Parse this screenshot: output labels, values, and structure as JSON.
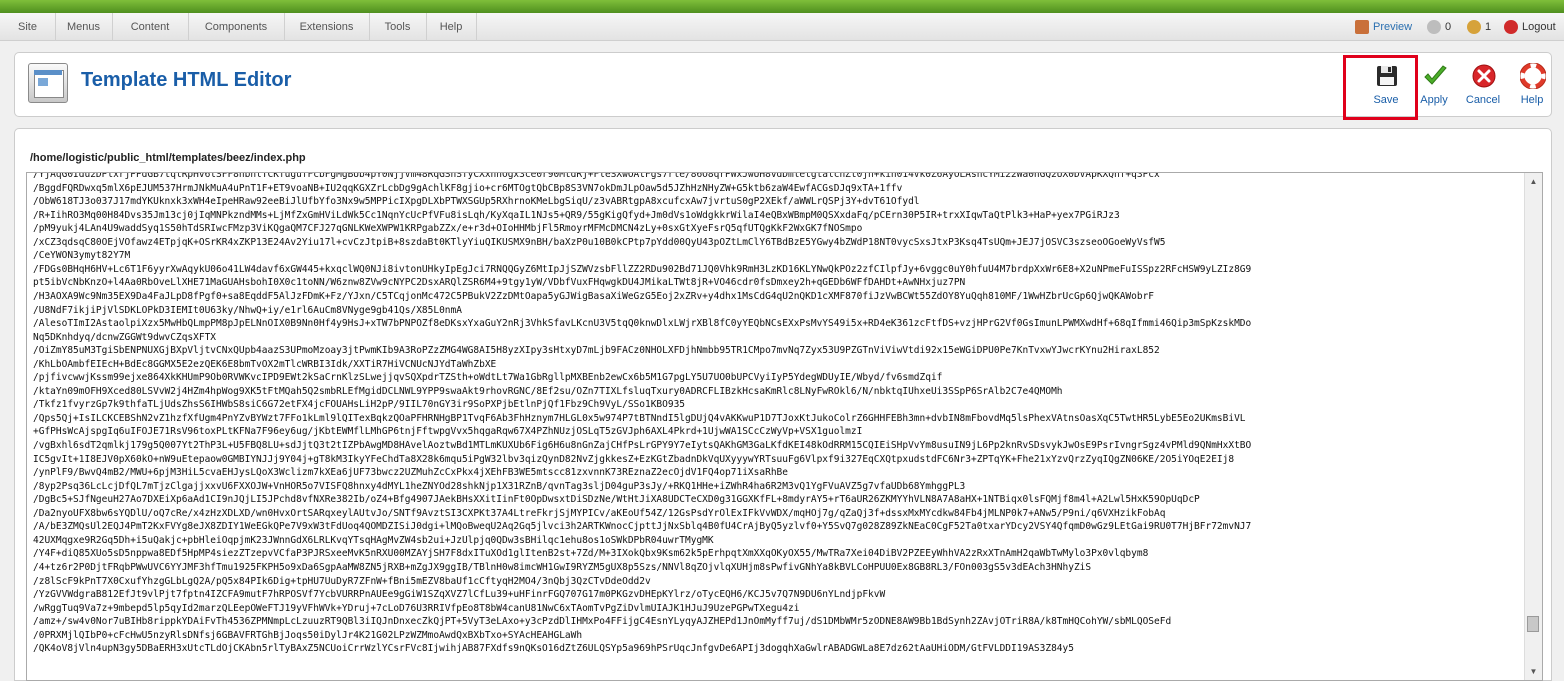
{
  "menu": {
    "items": [
      {
        "label": "Site"
      },
      {
        "label": "Menus"
      },
      {
        "label": "Content"
      },
      {
        "label": "Components"
      },
      {
        "label": "Extensions"
      },
      {
        "label": "Tools"
      },
      {
        "label": "Help"
      }
    ]
  },
  "status": {
    "preview": "Preview",
    "messages_count": "0",
    "users_count": "1",
    "logout": "Logout"
  },
  "header": {
    "title": "Template HTML Editor"
  },
  "toolbar": {
    "save": "Save",
    "apply": "Apply",
    "cancel": "Cancel",
    "help": "Help"
  },
  "editor": {
    "file_path": "/home/logistic/public_html/templates/beez/index.php",
    "lines": [
      "/YjAqG0Idu2DPlxrjPPdGB7tqlRpHv6lSFF8hbhlTCKfugufFcbFgMgBUb4pY0NjjVm48RqGSnSfyCXxhhOgx3ce0r90MtdRj+FleSXwOAtFgs7rle/86O8qrPWxJwUH8vdDmletgtalcnZt0jn+kin014Vk0Z6AyOLAshcYMi22Wa0hGQ2UX0DVApKXQhf+q3Pcx",
      "/BggdFQRDwxq5mlX6pEJUM537HrmJNkMuA4uPnT1F+ET9voaNB+IU2qqKGXZrLcbDg9gAchlKF8gjio+cr6MTOgtQbCBp8S3VN7okDmJLpOaw5d5JZhHzNHyZW+G5ktb6zaW4EwfACGsDJq9xTA+1ffv",
      "/ObW618TJ3o037J17mdYKUknxk3xWH4eIpeHRaw92eeBiJlUfbYfo3Nx9w5MPPicIXpgDLXbPTWXSGUp5RXhrnoKMeLbgSiqU/z3vABRtgpA8xcufcxAw7jvrtuS0gP2XEkf/aWWLrQSPj3Y+dvT61Ofydl",
      "/R+IihRO3Mq00H84Dvs35Jm13cj0jIqMNPkzndMMs+LjMfZxGmHViLdWk5Cc1NqnYcUcPfVFu8isLqh/KyXqaIL1NJs5+QR9/55gKigQfyd+Jm0dVs1oWdgkkrWilaI4eQBxWBmpM0QSXxdaFq/pCErn30P5IR+trxXIqwTaQtPlk3+HaP+yex7PGiRJz3",
      "/pM9yukj4LAn4U9waddSyq1S50hTdSRIwcFMzp3ViKQgaQM7CFJ27qGNLKWeXWPW1KRPgabZZx/e+r3d+OIoHHMbjFl5RmoyrMFMcDMCN4zLy+0sxGtXyeFsrQ5qfUTQgKkF2WxGK7fNOSmpo",
      "/xCZ3qdsqC80OEjVOfawz4ETpjqK+OSrKR4xZKP13E24Av2Yiu17l+cvCzJtpiB+8szdaBt0KTlyYiuQIKUSMX9nBH/baXzP0u10B0kCPtp7pYdd00QyU43pOZtLmClY6TBdBzE5YGwy4bZWdP18NT0vycSxsJtxP3Ksq4TsUQm+JEJ7jOSVC3szseoOGoeWyVsfW5",
      "/CeYWON3ymyt82Y7M",
      "/FDGs0BHqH6HV+Lc6T1F6yyrXwAqykU06o41LW4davf6xGW445+kxqclWQ0NJi8ivtonUHkyIpEgJci7RNQQGyZ6MtIpJjSZWVzsbFllZZ2RDu902Bd71JQ0Vhk9RmH3LzKD16KLYNwQkPOz2zfCIlpfJy+6vggc0uY0hfuU4M7brdpXxWr6E8+X2uNPmeFuISSpz2RFcHSW9yLZIz8G9",
      "pt5ibVcNbKnzO+l4Aa0RbOveLlXHE71MaGUAHsbohI0X0c1toNN/W6znw8ZVw9cNYPC2DsxARQlZSR6M4+9tgy1yW/VDbfVuxFHqwgkDU4JMikaLTWt8jR+VO46cdr0fsDmxey2h+qGEDb6WFfDAHDt+AwNHxjuz7PN",
      "/H3AOXA9Wc9Nm35EX9Da4FaJLpD8fPgf0+sa8EqddF5AlJzFDmK+Fz/YJxn/C5TCqjonMc472C5PBukV2ZzDMtOapa5yGJWigBasaXiWeGzG5Eoj2xZRv+y4dhx1MsCdG4qU2nQKD1cXMF870fiJzVwBCWt55ZdOY8YuQqh810MF/1WwHZbrUcGp6QjwQKAWobrF",
      "/U8NdF7ikjiPjVlSDKLOPkD3IEMIt0U63ky/NhwQ+iy/e1rl6AuCm8VNyge9gb41Qs/X85L0nmA",
      "/AlesoTImI2AstaolpiXzx5MwHbQLmpPM8pJpELNnOIX0B9Nn0Hf4y9HsJ+xTW7bPNPOZf8eDKsxYxaGuY2nRj3VhkSfavLKcnU3V5tqQ0knwDlxLWjrXBl8fC0yYEQbNCsEXxPsMvYS49i5x+RD4eK361zcFtfDS+vzjHPrG2Vf0GsImunLPWMXwdHf+68qIfmmi46Qip3mSpKzskMDo",
      "Nq5DKnhdyq/dcnwZGGWt9dwvCZqsXFTX",
      "/OiZmY85uM3TgiSbENPNUXGjBXpVljtvCNxQUpb4aazS3UPmoMzoay3jtPwmKIb9A3RoPZzZMG4WG8AI5H8yzXIpy3sHtxyD7mLjb9FACz0NHOLXFDjhNmbb95TR1CMpo7mvNq7Zyx53U9PZGTnViViwVtdi92x15eWGiDPU0Pe7KnTvxwYJwcrKYnu2HiraxL852",
      "/KhLbOAmbfEIEcH+BdEc8GGMX5E2ezQEK6E8bmTvOX2mTlcWRBI3Idk/XXTiR7HiVCNUcNJYdTaWhZbXE",
      "/pjfivcwwjKssm99ejxe864XkKHUmP9Ob0RVWKvcIPD9EWt2kSaCrnKlzSLwejjqvSQXpdrTZSth+oWdtLt7Wa1GbRgllpMXBEnb2ewCx6b5M1G7pgLY5U7UO0bUPCVyiIyP5YdegWDUyIE/Wbyd/fv6smdZqif",
      "/ktaYn09mOFH9Xced80LSVvW2j4HZm4hpWog9XK5tFtMQah5Q2smbRLEfMgidDCLNWL9YPP9swaAkt9rhovRGNC/8Ef2su/OZn7TIXLfsluqTxury0ADRCFLIBzkHcsaKmRlc8LNyFwROkl6/N/nbktqIUhxeUi3SSpP6SrAlb2C7e4QMOMh",
      "/Tkfz1fvyrzGp7k9thfaTLjUdsZhsS6IHWbS8siC6G72etFX4jcFOUAHsLiH2pP/9IIL70nGY3ir9SoPXPjbEtlnPjQf1Fbz9Ch9VyL/SSo1KBO935",
      "/Qps5Qj+IsILCKCEBShN2vZ1hzfXfUgm4PnYZvBYWzt7FFo1kLml9lQITexBqkzQOaPFHRNHgBP1TvqF6Ab3FhHznym7HLGL0x5w974P7tBTNndI5lgDUjQ4vAKKwuP1D7TJoxKtJukoColrZ6GHHFEBh3mn+dvbIN8mFbovdMq5lsPhexVAtnsOasXqC5TwtHR5LybE5Eo2UKmsBiVL",
      "+GfPHsWcAjspgIq6uIFOJE71RsV96toxPLtKFNa7F96ey6ug/jKbtEWMflLMhGP6tnjFftwpgVvx5hqgaRqw67X4PZhNUzjOSLqT5zGVJph6AXL4Pkrd+1UjwWA1SCcCzWyVp+VSX1guolmzI",
      "/vgBxhl6sdT2qmlkj179g5Q007Yt2ThP3L+U5FBQ8LU+sdJjtQ3t2tIZPbAwgMD8HAvelAoztwBd1MTLmKUXUb6Fig6H6u8nGnZajCHfPsLrGPY9Y7eIytsQAKhGM3GaLKfdKEI48kOdRRM15CQIEiSHpVvYm8usuIN9jL6Pp2knRvSDsvykJwOsE9PsrIvngrSgz4vPMld9QNmHxXtBO",
      "IC5gvIt+1I8EJV0pX60kO+nW9uEtepaow0GMBIYNJJj9Y04j+gT8kM3IkyYFeChdTa8X28k6mqu5iPgW32lbv3qizQynD82NvZjgkkesZ+EzKGtZbadnDkVqUXyyywYRTsuuFg6Vlpxf9i327EqCXQtpxudstdFC6Nr3+ZPTqYK+Fhe21xYzvQrzZyqIQgZN06KE/2O5iYOqE2EIj8",
      "/ynPlF9/BwvQ4mB2/MWU+6pjM3HiL5cvaEHJysLQoX3Wclizm7kXEa6jUF73bwcz2UZMuhZcCxPkx4jXEhFB3WE5mtscc81zxvnnK73REznaZ2ecOjdV1FQ4op71iXsaRhBe",
      "/8yp2Psq36LcLcjDfQL7mTjzClgajjxxvU6FXXOJW+VnHOR5o7VISFQ8hnxy4dMYL1heZNYOd28shkNjp1X31RZnB/qvnTag3sljD04guP3sJy/+RKQ1HHe+iZWhR4ha6R2M3vQ1YgFVuAVZ5g7vfaUDb68YmhggPL3",
      "/DgBc5+SJfNgeuH27Ao7DXEiXp6aAd1CI9nJQjLI5JPchd8vfNXRe382Ib/oZ4+Bfg4907JAekBHsXXitIinFt0OpDwsxtDiSDzNe/WtHtJiXA8UDCTeCXD0g31GGXKfFL+8mdyrAY5+rT6aUR26ZKMYYhVLN8A7A8aHX+1NTBiqx0lsFQMjf8m4l+A2Lwl5HxK59OpUqDcP",
      "/Da2nyoUFX8bw6sYQDlU/oQ7cRe/x4zHzXDLXD/wn0HvxOrtSARqxeylAUtvJo/SNTf9AvztSI3CXPKt37A4LtreFkrjSjMYPICv/aKEoUf54Z/12GsPsdYrOlExIFkVvWDX/mqHOj7g/qZaQj3f+dssxMxMYcdkw84Fb4jMLNP0k7+ANw5/P9ni/q6VXHzikFobAq",
      "/A/bE3ZMQsUl2EQJ4PmT2KxFVYg8eJX8ZDIY1WeEGkQPe7V9xW3tFdUoq4QOMDZISiJ0dgi+lMQoBweqU2Aq2Gq5jlvci3h2ARTKWnocCjpttJjNxSblq4B0fU4CrAjByQ5yzlvf0+Y5SvQ7g028Z89ZkNEaC0CgF52Ta0txarYDcy2VSY4QfqmD0wGz9LEtGai9RU0T7HjBFr72mvNJ7",
      "42UXMqgxe9R2Gq5Dh+i5uQakjc+pbHleiOqpjmK23JWnnGdX6LRLKvqYTsqHAgMvZW4sb2ui+JzUlpjq0QDw3sBHilqc1ehu8os1oSWkDPbR04uwrTMygMK",
      "/Y4F+diQ85XUo5sD5nppwa8EDf5HpMP4siezZTzepvVCfaP3PJRSxeeMvK5nRXU00MZAYjSH7F8dxITuXOd1glItenB2st+7Zd/M+3IXokQbx9Ksm62k5pErhpqtXmXXqOKyOX55/MwTRa7Xei04DiBV2PZEEyWhhVA2zRxXTnAmH2qaWbTwMylo3Px0vlqbym8",
      "/4+tz6r2P0DjtFRqbPWwUVC6YYJMF3hfTmu1925FKPH5o9xDa6SgpAaMW8ZN5jRXB+mZgJX9ggIB/TBlnH0w8imcWH1GwI9RYZM5gUX8p5Szs/NNVl8qZOjvlqXUHjm8sPwfivGNhYa8kBVLCoHPUU0Ex8GB8RL3/FOn003gS5v3dEAch3HNhyZiS",
      "/z8lScF9kPnT7X0CxufYhzgGLbLgQ2A/pQ5x84PIk6Dig+tpHU7UuDyR7ZFnW+fBni5mEZV8baUf1cCftyqH2MO4/3nQbj3QzCTvDdeOdd2v",
      "/YzGVVWdgraB812EfJt9vlPjt7fptn4IZCFA9mutF7hRPOSVf7YcbVURRPnAUEe9gGiW1SZqXVZ7lCfLu39+uHFinrFGQ707G17m0PKGzvDHEpKYlrz/oTycEQH6/KCJ5v7Q7N9DU6nYLndjpFkvW",
      "/wRggTuq9Va7z+9mbepd5lp5qyId2marzQLEepOWeFTJ19yVFhWVk+YDruj+7cLoD76U3RRIVfpEo8T8bW4canU81NwC6xTAomTvPgZiDvlmUIAJK1HJuJ9UzePGPwTXegu4zi",
      "/amz+/sw4v0Nor7uBIHb8rippkYDAiFvTh4536ZPMNmpLcLzuuzRT9QBl3iIQJnDnxecZkQjPT+5VyT3eLAxo+y3cPzdDlIHMxPo4FFijgC4EsnYLyqyAJZHEPd1JnOmMyff7uj/dS1DMbWMr5zODNE8AW9Bb1BdSynh2ZAvjOTriR8A/k8TmHQCohYW/sbMLQOSeFd",
      "/0PRXMjlQIbP0+cFcHwU5nzyRlsDNfsj6GBAVFRTGhBjJoqs50iDylJr4K21G02LPzWZMmoAwdQxBXbTxo+SYAcHEAHGLaWh",
      "/QK4oV8jVln4upN3gy5DBaERH3xUtcTLdOjCKAbn5rlTyBAxZ5NCUoiCrrWzlYCsrFVc8IjwihjAB87FXdfs9nQKsO16dZtZ6ULQSYp5a969hPSrUqcJnfgvDe6APIj3dogqhXaGwlrABADGWLa8E7dz62tAaUHiODM/GtFVLDDI19AS3Z84y5"
    ]
  }
}
